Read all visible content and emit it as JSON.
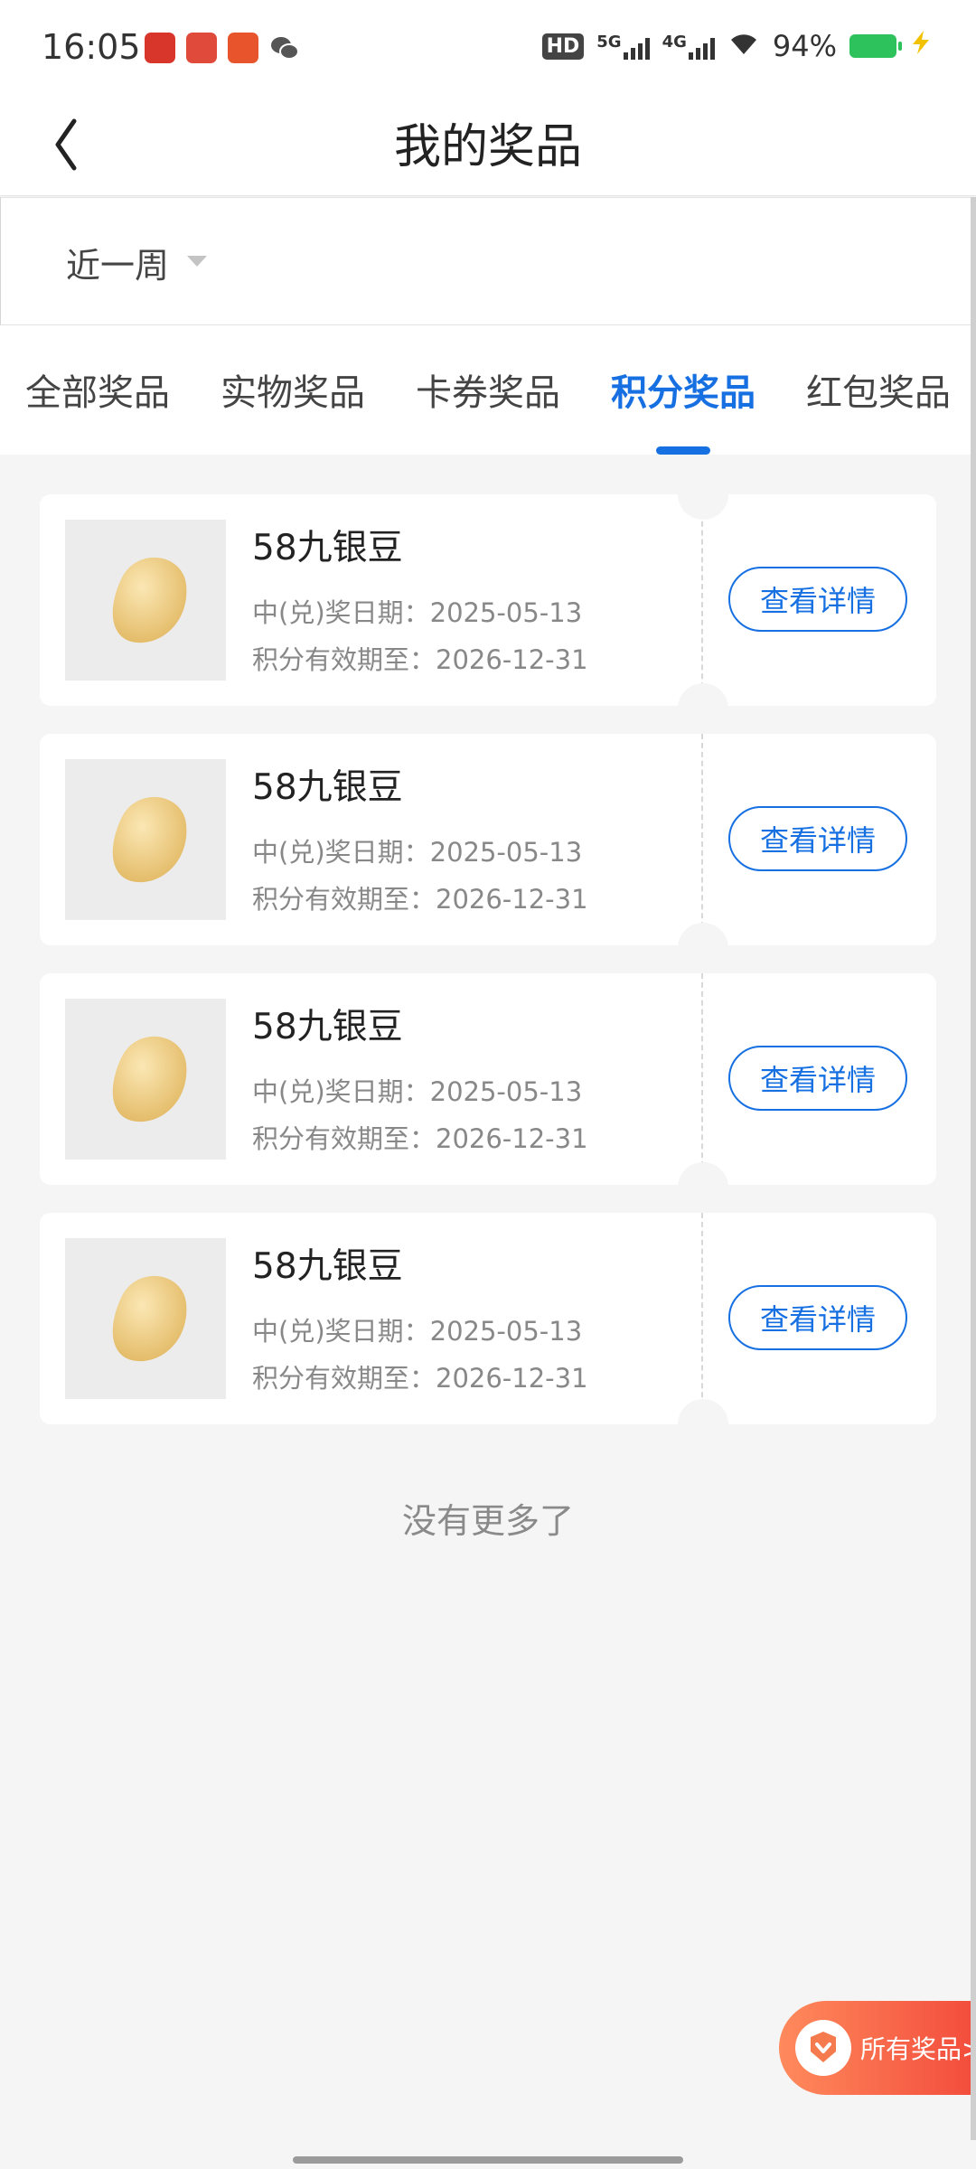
{
  "status_bar": {
    "time": "16:05",
    "battery": "94%",
    "network_5g": "5G",
    "network_4g": "4G",
    "hd": "HD"
  },
  "header": {
    "title": "我的奖品"
  },
  "filter": {
    "period": "近一周"
  },
  "tabs": [
    {
      "label": "全部奖品",
      "active": false
    },
    {
      "label": "实物奖品",
      "active": false
    },
    {
      "label": "卡券奖品",
      "active": false
    },
    {
      "label": "积分奖品",
      "active": true
    },
    {
      "label": "红包奖品",
      "active": false
    }
  ],
  "prizes": [
    {
      "name": "58九银豆",
      "win_date": "中(兑)奖日期：2025-05-13",
      "expiry": "积分有效期至：2026-12-31",
      "button": "查看详情"
    },
    {
      "name": "58九银豆",
      "win_date": "中(兑)奖日期：2025-05-13",
      "expiry": "积分有效期至：2026-12-31",
      "button": "查看详情"
    },
    {
      "name": "58九银豆",
      "win_date": "中(兑)奖日期：2025-05-13",
      "expiry": "积分有效期至：2026-12-31",
      "button": "查看详情"
    },
    {
      "name": "58九银豆",
      "win_date": "中(兑)奖日期：2025-05-13",
      "expiry": "积分有效期至：2026-12-31",
      "button": "查看详情"
    }
  ],
  "footer_text": "没有更多了",
  "floating_button": {
    "label": "所有奖品>"
  },
  "colors": {
    "accent": "#1670e2",
    "float_start": "#ff8a5c",
    "float_end": "#f24a3b"
  }
}
